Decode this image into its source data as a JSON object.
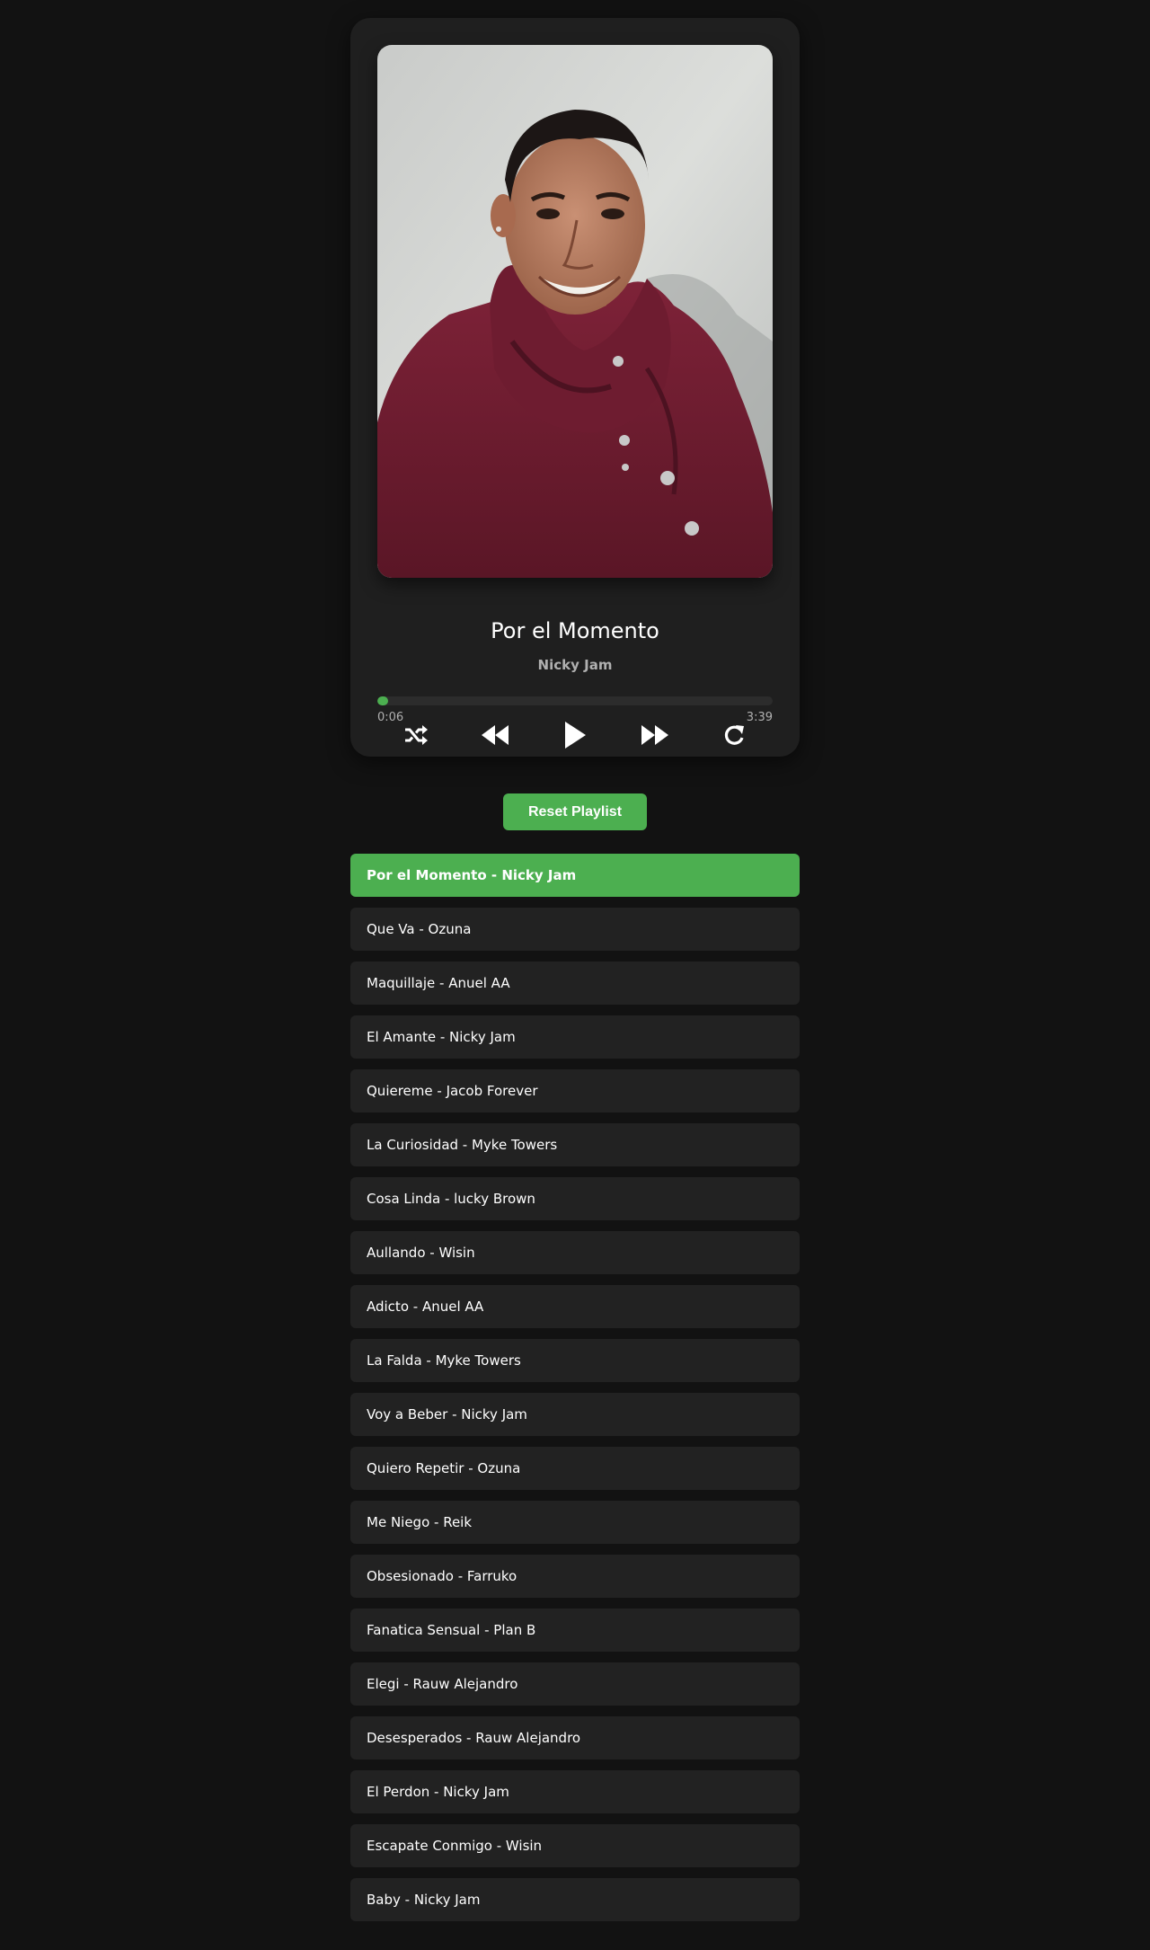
{
  "player": {
    "title": "Por el Momento",
    "artist": "Nicky Jam",
    "current_time": "0:06",
    "total_time": "3:39",
    "progress_fraction": 0.027,
    "cover_icon": "album-cover-photo",
    "icons": {
      "shuffle": "shuffle-icon",
      "previous": "rewind-icon",
      "play": "play-icon",
      "next": "fast-forward-icon",
      "repeat": "repeat-icon"
    }
  },
  "reset_label": "Reset Playlist",
  "playlist": [
    "Por el Momento - Nicky Jam",
    "Que Va - Ozuna",
    "Maquillaje - Anuel AA",
    "El Amante - Nicky Jam",
    "Quiereme - Jacob Forever",
    "La Curiosidad - Myke Towers",
    "Cosa Linda - lucky Brown",
    "Aullando - Wisin",
    "Adicto - Anuel AA",
    "La Falda - Myke Towers",
    "Voy a Beber - Nicky Jam",
    "Quiero Repetir - Ozuna",
    "Me Niego - Reik",
    "Obsesionado - Farruko",
    "Fanatica Sensual - Plan B",
    "Elegi - Rauw Alejandro",
    "Desesperados - Rauw Alejandro",
    "El Perdon - Nicky Jam",
    "Escapate Conmigo - Wisin",
    "Baby - Nicky Jam"
  ],
  "active_index": 0,
  "colors": {
    "accent": "#4caf50",
    "background": "#121212",
    "card": "#1f1f1f",
    "list_item": "#222222"
  }
}
